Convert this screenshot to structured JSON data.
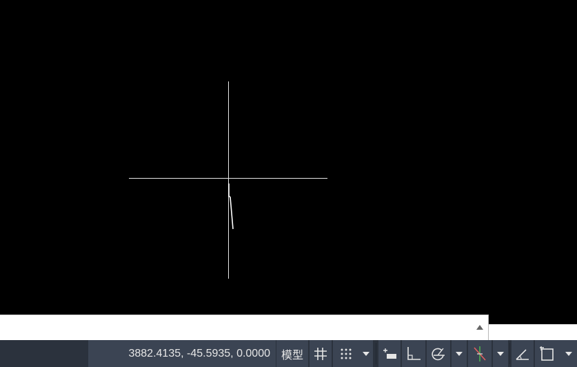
{
  "canvas": {
    "background": "#000000",
    "crosshair_color": "#e8e8e8"
  },
  "command_line": {
    "value": "",
    "placeholder": "",
    "history_arrow": "triangle-up-icon"
  },
  "statusbar": {
    "coordinates": "3882.4135, -45.5935, 0.0000",
    "model_label": "模型",
    "buttons": [
      {
        "name": "grid-icon"
      },
      {
        "name": "snap-icon"
      },
      {
        "name": "dropdown-arrow-icon"
      },
      {
        "name": "dynamic-input-icon"
      },
      {
        "name": "ortho-icon"
      },
      {
        "name": "polar-tracking-icon"
      },
      {
        "name": "dropdown-arrow-icon"
      },
      {
        "name": "object-snap-icon"
      },
      {
        "name": "dropdown-arrow-icon"
      },
      {
        "name": "angle-icon"
      },
      {
        "name": "snap-rectangle-icon"
      },
      {
        "name": "dropdown-arrow-icon"
      }
    ],
    "colors": {
      "bar": "#2b323d",
      "field": "#3b4453",
      "text": "#e6e6e6"
    }
  }
}
